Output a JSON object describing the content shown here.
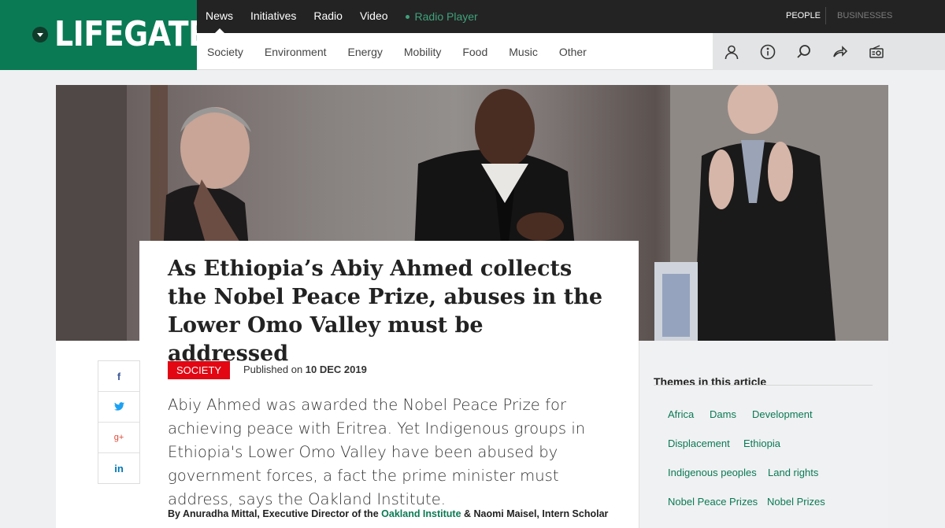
{
  "brand": {
    "logo_text": "LIFEGATE"
  },
  "topnav": {
    "items": [
      "News",
      "Initiatives",
      "Radio",
      "Video"
    ],
    "radio_player": "Radio Player",
    "people": "PEOPLE",
    "businesses": "BUSINESSES"
  },
  "subnav": {
    "items": [
      "Society",
      "Environment",
      "Energy",
      "Mobility",
      "Food",
      "Music",
      "Other"
    ]
  },
  "toolbar_icons": [
    "user-icon",
    "info-icon",
    "search-icon",
    "share-icon",
    "radio-icon"
  ],
  "article": {
    "title": "As Ethiopia’s Abiy Ahmed collects the Nobel Peace Prize, abuses in the Lower Omo Valley must be addressed",
    "category": "SOCIETY",
    "published_label": "Published on",
    "published_date": "10 DEC 2019",
    "lead": "Abiy Ahmed was awarded the Nobel Peace Prize for achieving peace with Eritrea. Yet Indigenous groups in Ethiopia's Lower Omo Valley have been abused by government forces, a fact the prime minister must address, says the Oakland Institute.",
    "byline_pre": "By Anuradha Mittal, Executive Director of the",
    "byline_link": "Oakland Institute",
    "byline_post": "& Naomi Maisel, Intern Scholar"
  },
  "share": [
    "f",
    "t",
    "g+",
    "in"
  ],
  "sidebar": {
    "title": "Themes in this article",
    "themes": [
      "Africa",
      "Dams",
      "Development",
      "Displacement",
      "Ethiopia",
      "Indigenous peoples",
      "Land rights",
      "Nobel Peace Prizes",
      "Nobel Prizes"
    ]
  },
  "colors": {
    "brand_green": "#0a7a55",
    "accent_red": "#e30613",
    "topbar": "#232323"
  }
}
